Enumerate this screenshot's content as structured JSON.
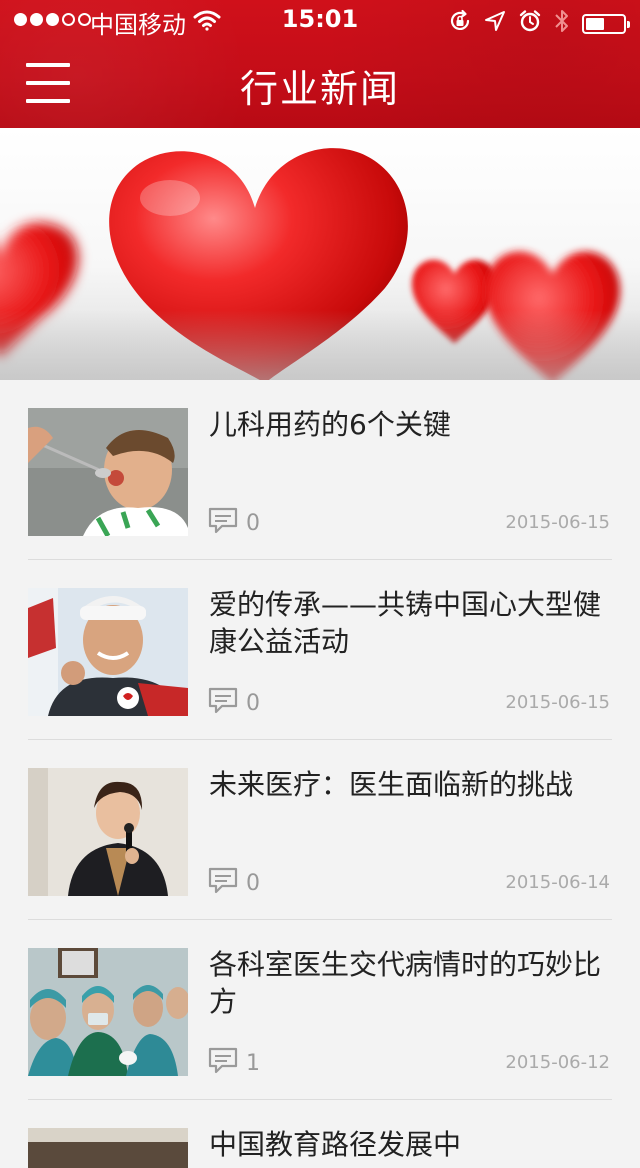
{
  "status_bar": {
    "carrier": "中国移动",
    "time": "15:01"
  },
  "header": {
    "title": "行业新闻"
  },
  "icons": {
    "menu": "hamburger-menu-icon",
    "wifi": "wifi-icon",
    "comment": "comment-bubble-icon",
    "battery": "battery-icon",
    "bluetooth": "bluetooth-icon",
    "alarm": "alarm-icon",
    "location": "location-arrow-icon",
    "rotation_lock": "rotation-lock-icon"
  },
  "colors": {
    "header_red": "#c40d18",
    "background": "#f3f3f3",
    "meta_gray": "#aaaaaa"
  },
  "news": [
    {
      "title": "儿科用药的6个关键",
      "comments": "0",
      "date": "2015-06-15"
    },
    {
      "title": "爱的传承——共铸中国心大型健康公益活动",
      "comments": "0",
      "date": "2015-06-15"
    },
    {
      "title": "未来医疗：医生面临新的挑战",
      "comments": "0",
      "date": "2015-06-14"
    },
    {
      "title": "各科室医生交代病情时的巧妙比方",
      "comments": "1",
      "date": "2015-06-12"
    },
    {
      "title": "中国教育路径发展中"
    }
  ]
}
